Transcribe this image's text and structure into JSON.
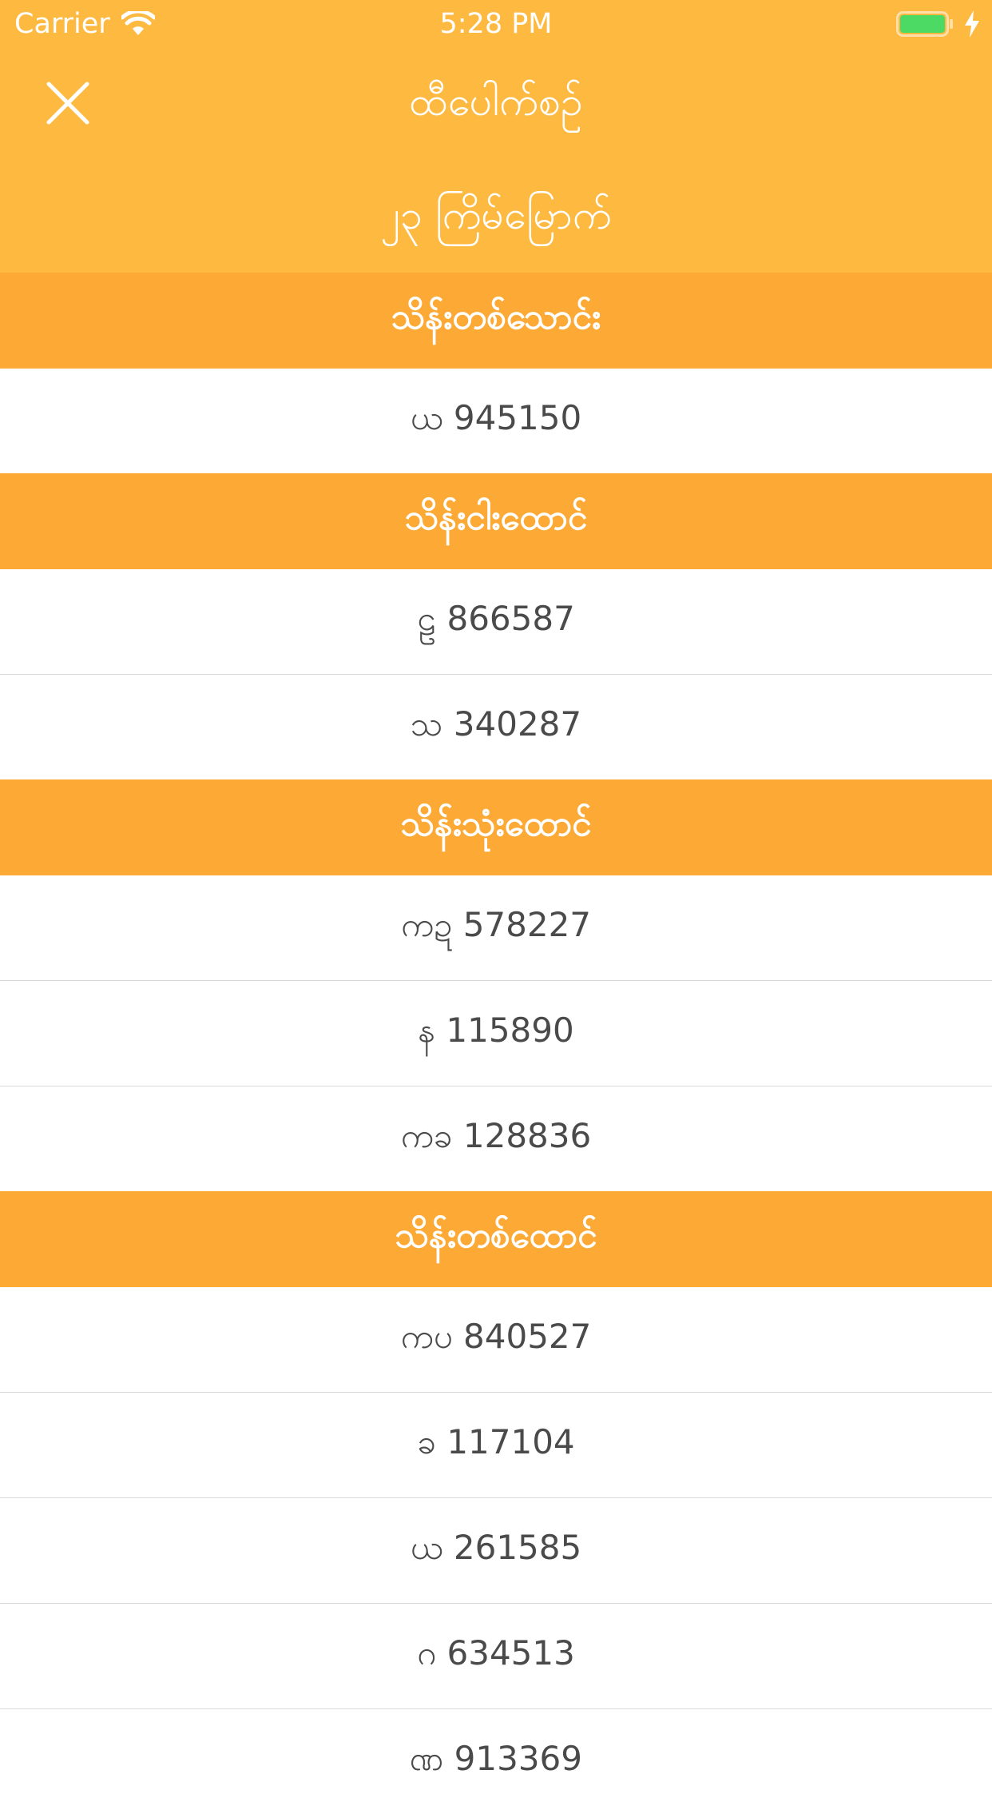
{
  "status_bar": {
    "carrier": "Carrier",
    "time": "5:28 PM"
  },
  "header": {
    "title": "ထီပေါက်စဉ်",
    "draw_label": "၂၃ ကြိမ်မြောက်"
  },
  "colors": {
    "header_bg": "#FEB940",
    "section_bg": "#FDA935",
    "battery_green": "#4CD964"
  },
  "icons": {
    "close": "close-icon",
    "wifi": "wifi-icon",
    "battery": "battery-icon",
    "charging": "bolt-icon"
  },
  "sections": [
    {
      "title": "သိန်းတစ်သောင်း",
      "numbers": [
        "ယ 945150"
      ]
    },
    {
      "title": "သိန်းငါးထောင်",
      "numbers": [
        "ဠ 866587",
        "သ 340287"
      ]
    },
    {
      "title": "သိန်းသုံးထောင်",
      "numbers": [
        "ကဍ 578227",
        "န 115890",
        "ကခ 128836"
      ]
    },
    {
      "title": "သိန်းတစ်ထောင်",
      "numbers": [
        "ကပ 840527",
        "ခ 117104",
        "ယ 261585",
        "ဂ 634513",
        "ဏ 913369"
      ]
    }
  ]
}
